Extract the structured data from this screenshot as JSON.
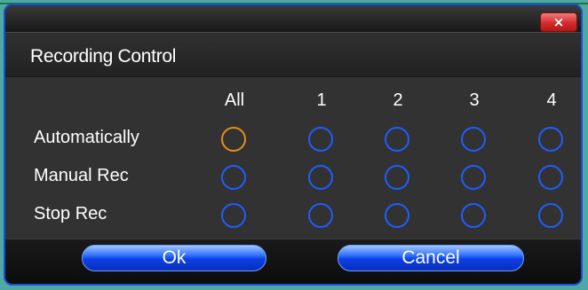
{
  "window": {
    "close_icon": "×"
  },
  "header": {
    "title": "Recording Control"
  },
  "grid": {
    "columns": [
      "All",
      "1",
      "2",
      "3",
      "4"
    ],
    "rows": [
      {
        "label": "Automatically",
        "selected_column": "All"
      },
      {
        "label": "Manual Rec",
        "selected_column": null
      },
      {
        "label": "Stop Rec",
        "selected_column": null
      }
    ]
  },
  "footer": {
    "ok_label": "Ok",
    "cancel_label": "Cancel"
  },
  "colors": {
    "radio_border": "#1f5dff",
    "radio_selected": "#e08f1a",
    "button_accent": "#0b3fe6",
    "close_button": "#d52b2b"
  }
}
